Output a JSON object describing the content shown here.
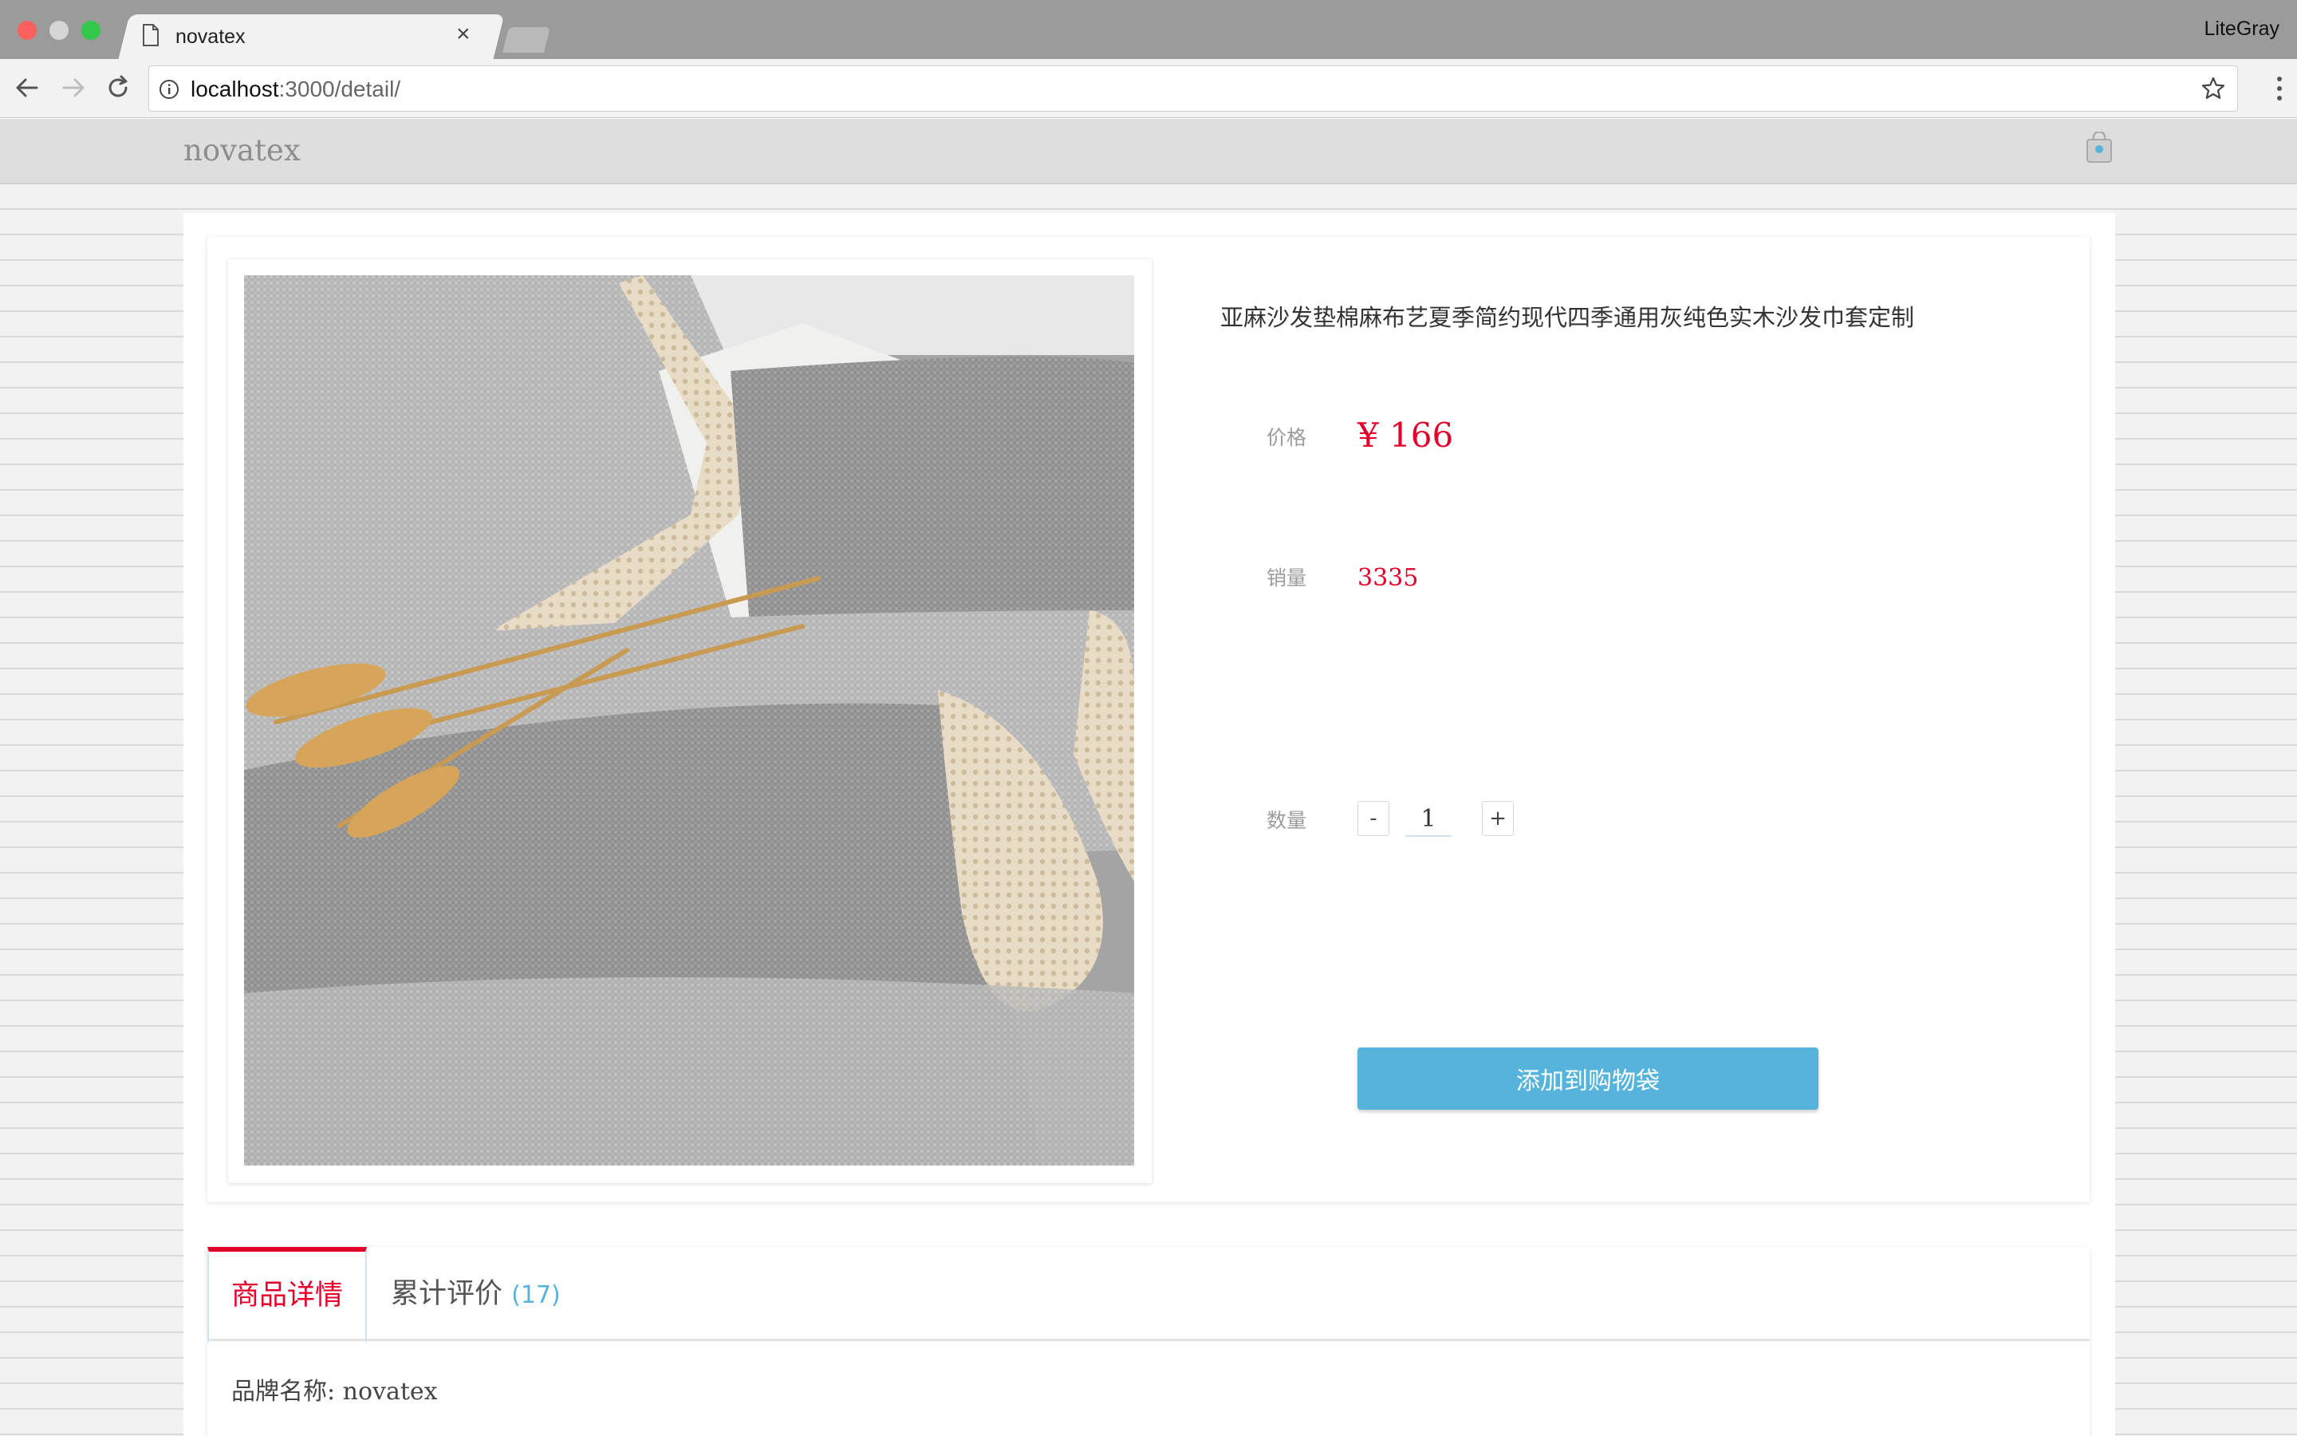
{
  "browser": {
    "tab_title": "novatex",
    "tab_close": "×",
    "profile_name": "LiteGray",
    "url_host": "localhost",
    "url_rest": ":3000/detail/"
  },
  "site": {
    "logo": "novatex"
  },
  "product": {
    "title": "亚麻沙发垫棉麻布艺夏季简约现代四季通用灰纯色实木沙发巾套定制",
    "price_label": "价格",
    "price_value": "¥ 166",
    "sales_label": "销量",
    "sales_value": "3335",
    "quantity_label": "数量",
    "quantity_minus": "-",
    "quantity_value": "1",
    "quantity_plus": "+",
    "add_to_bag": "添加到购物袋"
  },
  "tabs": {
    "details_label": "商品详情",
    "reviews_label": "累计评价",
    "reviews_count": "(17)"
  },
  "details": {
    "brand_line": "品牌名称: novatex"
  },
  "colors": {
    "accent_red": "#e4002b",
    "accent_blue": "#56b4dc"
  },
  "icons": [
    "document-icon",
    "close-icon",
    "back-arrow-icon",
    "forward-arrow-icon",
    "reload-icon",
    "info-icon",
    "star-icon",
    "menu-icon",
    "shopping-bag-icon"
  ]
}
